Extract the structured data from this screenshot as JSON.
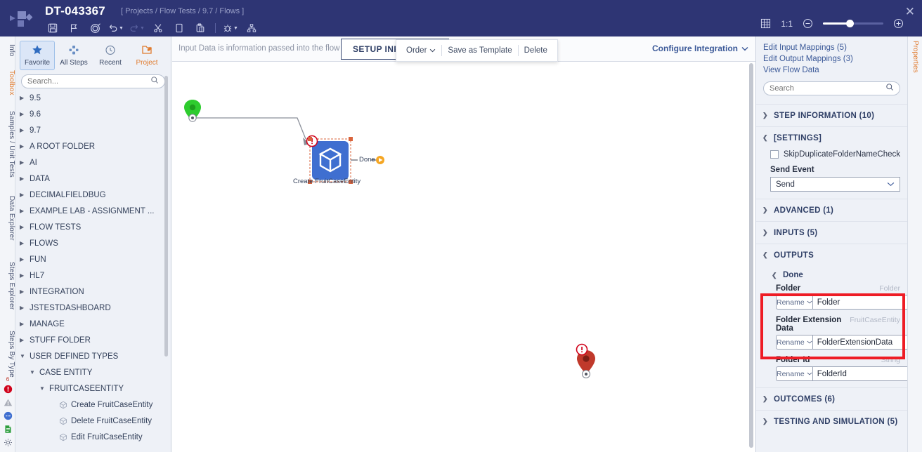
{
  "header": {
    "title": "DT-043367",
    "breadcrumb": "[ Projects / Flow Tests / 9.7 / Flows ]",
    "close_label": "✕",
    "toolbar": [
      {
        "name": "save-icon",
        "glyph": "save",
        "disabled": false,
        "caret": false
      },
      {
        "name": "flag-icon",
        "glyph": "flag",
        "disabled": false,
        "caret": false
      },
      {
        "name": "target-icon",
        "glyph": "target",
        "disabled": false,
        "caret": false
      },
      {
        "name": "undo-icon",
        "glyph": "undo",
        "disabled": false,
        "caret": true
      },
      {
        "name": "redo-icon",
        "glyph": "redo",
        "disabled": true,
        "caret": true
      },
      {
        "name": "cut-icon",
        "glyph": "scissors",
        "disabled": false,
        "caret": false
      },
      {
        "name": "copy-icon",
        "glyph": "copy",
        "disabled": false,
        "caret": false
      },
      {
        "name": "paste-icon",
        "glyph": "paste",
        "disabled": false,
        "caret": false
      },
      {
        "name": "divider",
        "glyph": "divider",
        "disabled": false,
        "caret": false
      },
      {
        "name": "debug-icon",
        "glyph": "bug",
        "disabled": false,
        "caret": true
      },
      {
        "name": "hierarchy-icon",
        "glyph": "sitemap",
        "disabled": false,
        "caret": false
      }
    ],
    "zoom_tools": {
      "grid_icon": "grid-icon",
      "actual_size_label": "1:1",
      "zoom_out_label": "−",
      "zoom_in_label": "+",
      "slider_value": 38
    }
  },
  "left_rail": {
    "tabs": [
      {
        "label": "Info",
        "active": false
      },
      {
        "label": "Toolbox",
        "active": true
      },
      {
        "label": "Samples / Unit Tests",
        "active": false
      },
      {
        "label": "Data Explorer",
        "active": false
      },
      {
        "label": "Steps Explorer",
        "active": false
      },
      {
        "label": "Steps By Type",
        "active": false
      }
    ],
    "status_icons": [
      {
        "name": "error-count-badge",
        "label": "6"
      },
      {
        "name": "error-icon",
        "label": ""
      },
      {
        "name": "warning-icon",
        "label": ""
      },
      {
        "name": "comment-icon",
        "label": ""
      },
      {
        "name": "document-icon",
        "label": ""
      },
      {
        "name": "settings-gear-icon",
        "label": ""
      }
    ]
  },
  "toolbox": {
    "modes": [
      {
        "label": "Favorite",
        "icon": "star-icon",
        "active": true
      },
      {
        "label": "All Steps",
        "icon": "all-steps-icon",
        "active": false
      },
      {
        "label": "Recent",
        "icon": "clock-icon",
        "active": false
      },
      {
        "label": "Project",
        "icon": "project-icon",
        "active": false,
        "accent": true
      }
    ],
    "search_placeholder": "Search...",
    "search_value": "",
    "tree": [
      {
        "label": "9.5",
        "indent": 0,
        "expanded": false,
        "leaf": false
      },
      {
        "label": "9.6",
        "indent": 0,
        "expanded": false,
        "leaf": false
      },
      {
        "label": "9.7",
        "indent": 0,
        "expanded": false,
        "leaf": false
      },
      {
        "label": "A ROOT FOLDER",
        "indent": 0,
        "expanded": false,
        "leaf": false
      },
      {
        "label": "AI",
        "indent": 0,
        "expanded": false,
        "leaf": false
      },
      {
        "label": "DATA",
        "indent": 0,
        "expanded": false,
        "leaf": false
      },
      {
        "label": "DECIMALFIELDBUG",
        "indent": 0,
        "expanded": false,
        "leaf": false
      },
      {
        "label": "EXAMPLE LAB - ASSIGNMENT ...",
        "indent": 0,
        "expanded": false,
        "leaf": false
      },
      {
        "label": "FLOW TESTS",
        "indent": 0,
        "expanded": false,
        "leaf": false
      },
      {
        "label": "FLOWS",
        "indent": 0,
        "expanded": false,
        "leaf": false
      },
      {
        "label": "FUN",
        "indent": 0,
        "expanded": false,
        "leaf": false
      },
      {
        "label": "HL7",
        "indent": 0,
        "expanded": false,
        "leaf": false
      },
      {
        "label": "INTEGRATION",
        "indent": 0,
        "expanded": false,
        "leaf": false
      },
      {
        "label": "JSTESTDASHBOARD",
        "indent": 0,
        "expanded": false,
        "leaf": false
      },
      {
        "label": "MANAGE",
        "indent": 0,
        "expanded": false,
        "leaf": false
      },
      {
        "label": "STUFF FOLDER",
        "indent": 0,
        "expanded": false,
        "leaf": false
      },
      {
        "label": "USER DEFINED TYPES",
        "indent": 0,
        "expanded": true,
        "leaf": false
      },
      {
        "label": "CASE ENTITY",
        "indent": 1,
        "expanded": true,
        "leaf": false
      },
      {
        "label": "FRUITCASEENTITY",
        "indent": 2,
        "expanded": true,
        "leaf": false
      },
      {
        "label": "Create FruitCaseEntity",
        "indent": 3,
        "expanded": false,
        "leaf": true
      },
      {
        "label": "Delete FruitCaseEntity",
        "indent": 3,
        "expanded": false,
        "leaf": true
      },
      {
        "label": "Edit FruitCaseEntity",
        "indent": 3,
        "expanded": false,
        "leaf": true
      }
    ]
  },
  "flowbar": {
    "hint": "Input Data is information passed into the flow",
    "setup_button": "SETUP INPUT DATA",
    "configure_label": "Configure Integration",
    "context_menu": [
      {
        "label": "Order",
        "caret": true
      },
      {
        "label": "Save as Template",
        "caret": false
      },
      {
        "label": "Delete",
        "caret": false
      }
    ]
  },
  "canvas": {
    "start_marker": "start-marker",
    "step_label": "Create FruitCaseEntity",
    "outcome_label": "Done",
    "end_marker": "end-marker",
    "step_has_error": true
  },
  "properties": {
    "tab_label": "Properties",
    "links": [
      "Edit Input Mappings (5)",
      "Edit Output Mappings (3)",
      "View Flow Data"
    ],
    "search_placeholder": "Search",
    "search_value": "",
    "sections": [
      {
        "label": "STEP INFORMATION (10)",
        "expanded": false
      },
      {
        "label": "[SETTINGS]",
        "expanded": true
      },
      {
        "label": "ADVANCED (1)",
        "expanded": false
      },
      {
        "label": "INPUTS (5)",
        "expanded": false
      },
      {
        "label": "OUTPUTS",
        "expanded": true
      },
      {
        "label": "OUTCOMES (6)",
        "expanded": false
      },
      {
        "label": "TESTING AND SIMULATION (5)",
        "expanded": false
      }
    ],
    "settings": {
      "checkbox_label": "SkipDuplicateFolderNameCheck",
      "checkbox_checked": false,
      "send_event_label": "Send Event",
      "send_event_value": "Send"
    },
    "outputs": {
      "group_label": "Done",
      "rename_label": "Rename",
      "rows": [
        {
          "name": "Folder",
          "type": "Folder",
          "value": "Folder",
          "highlighted": true
        },
        {
          "name": "Folder Extension Data",
          "type": "FruitCaseEntity",
          "value": "FolderExtensionData",
          "highlighted": true
        },
        {
          "name": "Folder Id",
          "type": "String",
          "value": "FolderId",
          "highlighted": false
        }
      ]
    }
  },
  "colors": {
    "header_bg": "#2e3574",
    "accent_orange": "#e07b2e",
    "link_blue": "#3b5998",
    "highlight_red": "#ee1c25",
    "node_blue": "#3f6fd0",
    "start_green": "#2ecc2e",
    "end_red": "#c0392b"
  }
}
